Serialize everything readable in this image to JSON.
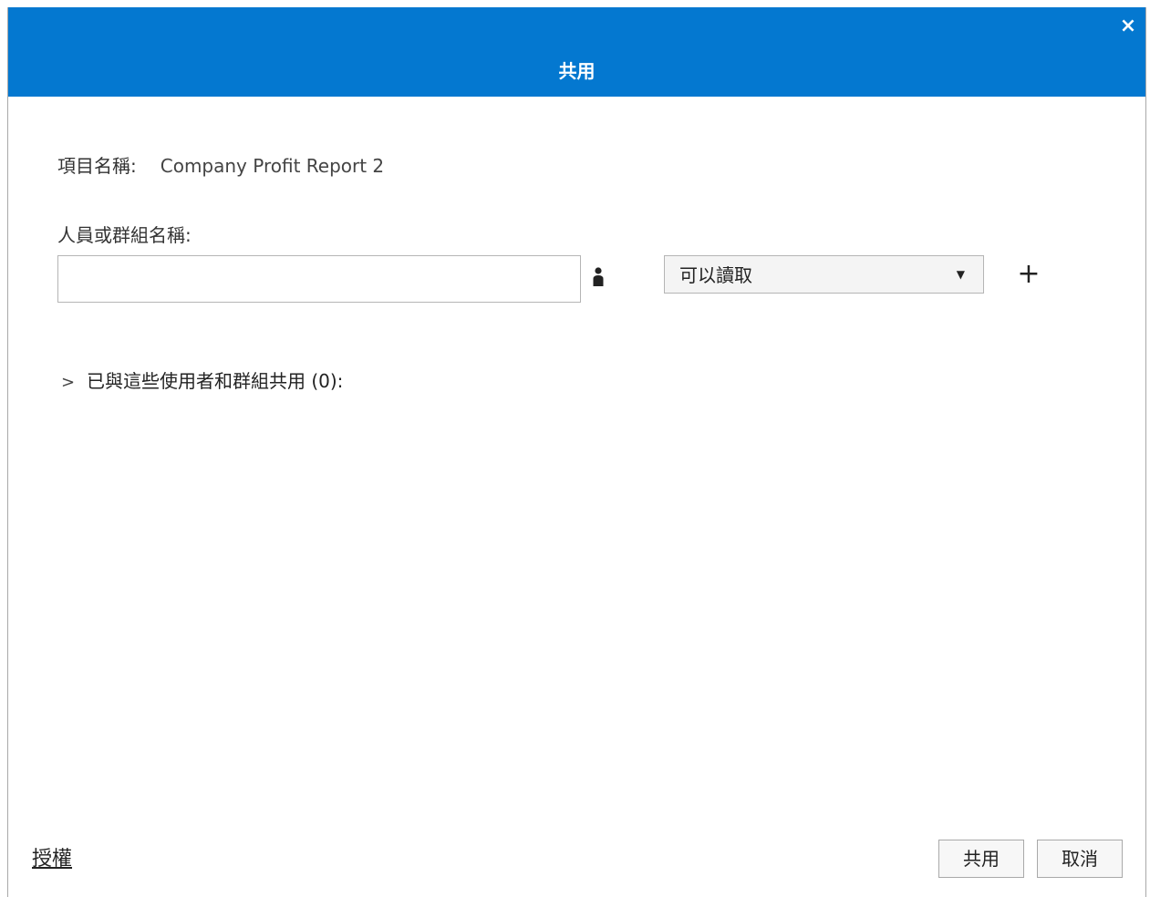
{
  "dialog": {
    "title": "共用",
    "close_glyph": "×"
  },
  "item": {
    "label": "項目名稱:",
    "value": "Company Profit Report 2"
  },
  "recipient": {
    "label": "人員或群組名稱:",
    "input_value": "",
    "input_placeholder": "",
    "icon": "person-icon"
  },
  "permission": {
    "selected": "可以讀取",
    "caret": "▼"
  },
  "add": {
    "glyph": "+"
  },
  "shared_section": {
    "chevron": ">",
    "label": "已與這些使用者和群組共用 (0):"
  },
  "footer": {
    "license_link": "授權",
    "share_button": "共用",
    "cancel_button": "取消"
  },
  "colors": {
    "titlebar": "#0478d0"
  }
}
